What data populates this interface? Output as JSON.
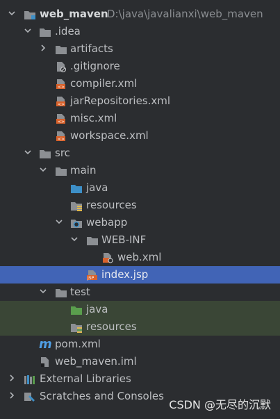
{
  "project": {
    "root": "web_maven",
    "path": "D:\\java\\javalianxi\\web_maven"
  },
  "tree": {
    "idea": ".idea",
    "artifacts": "artifacts",
    "gitignore": ".gitignore",
    "compiler": "compiler.xml",
    "jar_repos": "jarRepositories.xml",
    "misc": "misc.xml",
    "workspace": "workspace.xml",
    "src": "src",
    "main": "main",
    "main_java": "java",
    "main_resources": "resources",
    "webapp": "webapp",
    "web_inf": "WEB-INF",
    "web_xml": "web.xml",
    "index_jsp": "index.jsp",
    "test": "test",
    "test_java": "java",
    "test_resources": "resources",
    "pom": "pom.xml",
    "iml": "web_maven.iml",
    "external_libraries": "External Libraries",
    "scratches": "Scratches and Consoles"
  },
  "icons": {
    "folder_color": "#8c8f93",
    "source_folder_color": "#3d8fc7",
    "test_folder_color": "#5a9e4d",
    "xml_color": "#d9622b",
    "selection_color": "#4164b6"
  },
  "watermark": "CSDN @无尽的沉默"
}
